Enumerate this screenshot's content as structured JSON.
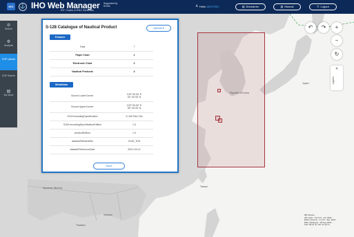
{
  "header": {
    "logo_text": "IHO",
    "emblem": "⚓",
    "title": "IHO Web Manager",
    "subtitle": "INT Charts & ENC Schemes",
    "supported_line1": "Supported by",
    "supported_line2": "KHOA",
    "greeting": "Hello",
    "username": "GEOTWO",
    "buttons": {
      "disclaimer": "Disclaimer",
      "manual": "Manual",
      "logout": "Logout"
    }
  },
  "sidebar": {
    "items": [
      {
        "label": "Search",
        "icon": "search-icon",
        "glyph": "⊘"
      },
      {
        "label": "Analysis",
        "icon": "analysis-icon",
        "glyph": "⚙"
      },
      {
        "label": "CNP Upload",
        "icon": "upload-icon",
        "glyph": ""
      },
      {
        "label": "CNP Search",
        "icon": "cnp-search-icon",
        "glyph": ""
      },
      {
        "label": "My Work",
        "icon": "work-icon",
        "glyph": "▤"
      }
    ]
  },
  "panel": {
    "title": "S-128 Catalogue of Nautical Product",
    "upload_label": "Upload ▾",
    "feature_tag": "Feature",
    "feature_rows": [
      {
        "key": "Total",
        "value": "7",
        "bold": false
      },
      {
        "key": "Paper Chart",
        "value": "1",
        "bold": true
      },
      {
        "key": "Electronic Chart",
        "value": "2",
        "bold": true
      },
      {
        "key": "Nautical Products",
        "value": "4",
        "bold": true
      }
    ],
    "metadata_tag": "MetaData",
    "metadata_rows": [
      {
        "key": "Bound LowerCorner",
        "value": "129° 00.00' E\n34° 00.00' N"
      },
      {
        "key": "Bound UpperCorner",
        "value": "129° 00.00' E\n35° 00.00' N"
      },
      {
        "key": "S100:encodingSpecification",
        "value": "S-100 Part 10b"
      },
      {
        "key": "S100:encodingSpecificationEdition",
        "value": "1.0"
      },
      {
        "key": "productEdition",
        "value": "1.0"
      },
      {
        "key": "datasetFileIdentifier",
        "value": "S128_TDS"
      },
      {
        "key": "datasetReferenceDate",
        "value": "2021-03-12"
      }
    ],
    "save_label": "Save"
  },
  "map": {
    "labels": {
      "korea": "Republic of Korea",
      "japan": "Japan",
      "myanmar": "Myanmar (Burma)",
      "thailand": "Thailand",
      "vietnam": "Vietnam",
      "taiwan": "Taiwan"
    },
    "controls": {
      "undo": "↶",
      "redo": "↷",
      "zoom_in": "+",
      "zoom_out": "−",
      "refresh": "↻"
    },
    "layers_label": "Layers",
    "layers_chevron": "«"
  },
  "info": {
    "line1": "DB Version",
    "line2": "INT chart : 3.6.174 - Jul. 2022",
    "line3": "ENCs scheme : 1.2.47 - Apr. 2021",
    "line4": "ENC catalogue : 26 Aug 2021 - ",
    "line5": "119° 00.12' E / 45° 31.12' N"
  },
  "colors": {
    "header": "#0c2958",
    "accent": "#1f8ee6",
    "coverage": "#a5333d"
  }
}
